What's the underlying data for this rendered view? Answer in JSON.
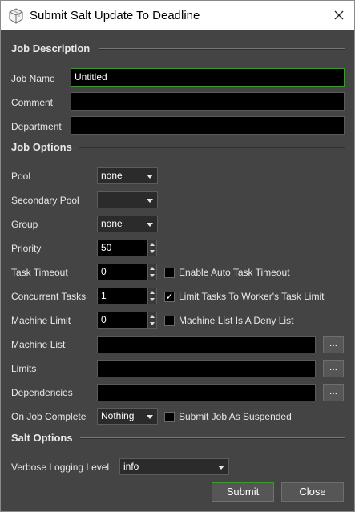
{
  "window": {
    "title": "Submit Salt Update To Deadline"
  },
  "job_description": {
    "heading": "Job Description",
    "job_name_label": "Job Name",
    "job_name_value": "Untitled",
    "comment_label": "Comment",
    "comment_value": "",
    "department_label": "Department",
    "department_value": ""
  },
  "job_options": {
    "heading": "Job Options",
    "pool_label": "Pool",
    "pool_value": "none",
    "secondary_pool_label": "Secondary Pool",
    "secondary_pool_value": "",
    "group_label": "Group",
    "group_value": "none",
    "priority_label": "Priority",
    "priority_value": "50",
    "task_timeout_label": "Task Timeout",
    "task_timeout_value": "0",
    "auto_timeout_label": "Enable Auto Task Timeout",
    "auto_timeout_checked": false,
    "concurrent_tasks_label": "Concurrent Tasks",
    "concurrent_tasks_value": "1",
    "limit_tasks_label": "Limit Tasks To Worker's Task Limit",
    "limit_tasks_checked": true,
    "machine_limit_label": "Machine Limit",
    "machine_limit_value": "0",
    "deny_list_label": "Machine List Is A Deny List",
    "deny_list_checked": false,
    "machine_list_label": "Machine List",
    "machine_list_value": "",
    "limits_label": "Limits",
    "limits_value": "",
    "dependencies_label": "Dependencies",
    "dependencies_value": "",
    "browse_label": "...",
    "on_complete_label": "On Job Complete",
    "on_complete_value": "Nothing",
    "suspended_label": "Submit Job As Suspended",
    "suspended_checked": false
  },
  "salt_options": {
    "heading": "Salt Options",
    "verbose_label": "Verbose Logging Level",
    "verbose_value": "info"
  },
  "buttons": {
    "submit": "Submit",
    "close": "Close"
  },
  "check_glyph": "✓",
  "colors": {
    "background": "#444444",
    "accent_focus": "#3c9a2c",
    "field": "#000000"
  }
}
